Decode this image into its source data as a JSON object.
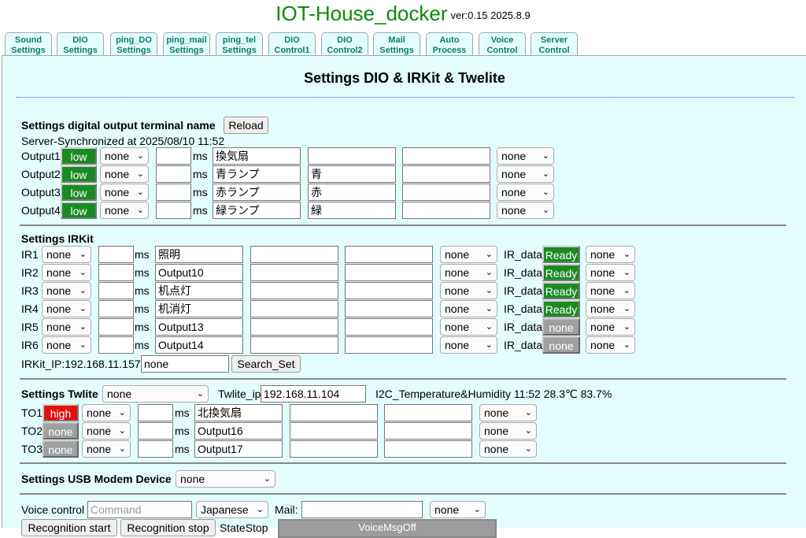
{
  "header": {
    "title": "IOT-House_docker",
    "version": "ver:0.15 2025.8.9"
  },
  "tabs": [
    {
      "line1": "Sound",
      "line2": "Settings"
    },
    {
      "line1": "DIO",
      "line2": "Settings"
    },
    {
      "line1": "ping_DO",
      "line2": "Settings"
    },
    {
      "line1": "ping_mail",
      "line2": "Settings"
    },
    {
      "line1": "ping_tel",
      "line2": "Settings"
    },
    {
      "line1": "DIO",
      "line2": "Control1"
    },
    {
      "line1": "DIO",
      "line2": "Control2"
    },
    {
      "line1": "Mail",
      "line2": "Settings"
    },
    {
      "line1": "Auto",
      "line2": "Process"
    },
    {
      "line1": "Voice",
      "line2": "Control"
    },
    {
      "line1": "Server",
      "line2": "Control"
    }
  ],
  "page": {
    "title": "Settings DIO & IRKit & Twelite"
  },
  "dio": {
    "heading": "Settings digital output terminal name",
    "reload_label": "Reload",
    "sync_text": "Server-Synchronized at 2025/08/10 11:52",
    "ms_label": "ms",
    "rows": [
      {
        "label": "Output1",
        "state": "low",
        "mode": "none",
        "ms": "",
        "name": "換気扇",
        "alias": "",
        "extra": "",
        "select": "none"
      },
      {
        "label": "Output2",
        "state": "low",
        "mode": "none",
        "ms": "",
        "name": "青ランプ",
        "alias": "青",
        "extra": "",
        "select": "none"
      },
      {
        "label": "Output3",
        "state": "low",
        "mode": "none",
        "ms": "",
        "name": "赤ランプ",
        "alias": "赤",
        "extra": "",
        "select": "none"
      },
      {
        "label": "Output4",
        "state": "low",
        "mode": "none",
        "ms": "",
        "name": "緑ランプ",
        "alias": "緑",
        "extra": "",
        "select": "none"
      }
    ]
  },
  "irkit": {
    "heading": "Settings IRKit",
    "ms_label": "ms",
    "irdata_label": "IR_data",
    "rows": [
      {
        "label": "IR1",
        "mode": "none",
        "ms": "",
        "name": "照明",
        "alias": "",
        "extra": "",
        "select": "none",
        "ir_state": "Ready",
        "select2": "none"
      },
      {
        "label": "IR2",
        "mode": "none",
        "ms": "",
        "name": "Output10",
        "alias": "",
        "extra": "",
        "select": "none",
        "ir_state": "Ready",
        "select2": "none"
      },
      {
        "label": "IR3",
        "mode": "none",
        "ms": "",
        "name": "机点灯",
        "alias": "",
        "extra": "",
        "select": "none",
        "ir_state": "Ready",
        "select2": "none"
      },
      {
        "label": "IR4",
        "mode": "none",
        "ms": "",
        "name": "机消灯",
        "alias": "",
        "extra": "",
        "select": "none",
        "ir_state": "Ready",
        "select2": "none"
      },
      {
        "label": "IR5",
        "mode": "none",
        "ms": "",
        "name": "Output13",
        "alias": "",
        "extra": "",
        "select": "none",
        "ir_state": "none",
        "select2": "none"
      },
      {
        "label": "IR6",
        "mode": "none",
        "ms": "",
        "name": "Output14",
        "alias": "",
        "extra": "",
        "select": "none",
        "ir_state": "none",
        "select2": "none"
      }
    ],
    "ip_label": "IRKit_IP:192.168.11.157",
    "ip_value": "none",
    "search_label": "Search_Set"
  },
  "twelite": {
    "heading": "Settings Twlite",
    "select": "none",
    "ip_label": "Twlite_ip",
    "ip_value": "192.168.11.104",
    "sensor_text": "I2C_Temperature&Humidity 11:52 28.3℃ 83.7%",
    "ms_label": "ms",
    "rows": [
      {
        "label": "TO1",
        "state": "high",
        "mode": "none",
        "ms": "",
        "name": "北換気扇",
        "alias": "",
        "extra": "",
        "select": "none"
      },
      {
        "label": "TO2",
        "state": "none",
        "mode": "none",
        "ms": "",
        "name": "Output16",
        "alias": "",
        "extra": "",
        "select": "none"
      },
      {
        "label": "TO3",
        "state": "none",
        "mode": "none",
        "ms": "",
        "name": "Output17",
        "alias": "",
        "extra": "",
        "select": "none"
      }
    ]
  },
  "usb": {
    "heading": "Settings USB Modem Device",
    "select": "none"
  },
  "voice": {
    "label": "Voice control",
    "command_placeholder": "Command",
    "language": "Japanese",
    "mail_label": "Mail:",
    "mail_value": "",
    "mail_select": "none",
    "rec_start": "Recognition start",
    "rec_stop": "Recognition stop",
    "state": "StateStop",
    "status_bar": "VoiceMsgOff"
  },
  "colors": {
    "accent": "#0d8a0d",
    "panel_bg": "#e3fcfc",
    "low": "#1a8a22",
    "high": "#e01010",
    "none": "#a0a0a0"
  }
}
